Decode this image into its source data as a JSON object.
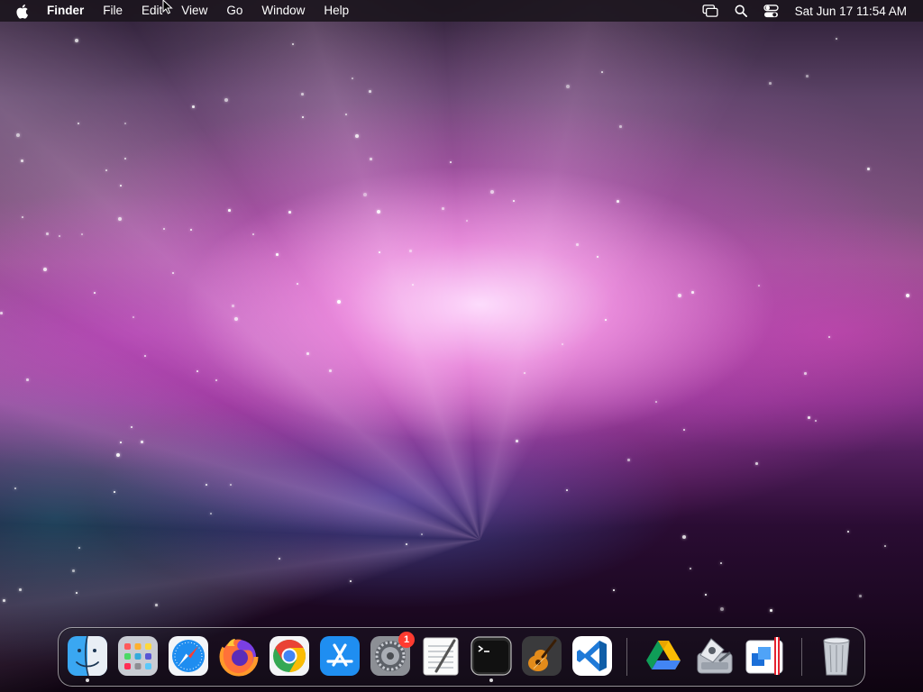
{
  "menubar": {
    "app_name": "Finder",
    "menus": [
      "File",
      "Edit",
      "View",
      "Go",
      "Window",
      "Help"
    ],
    "status_icons": [
      "screen-mirroring-icon",
      "spotlight-search-icon",
      "control-center-icon"
    ],
    "clock": "Sat Jun 17  11:54 AM"
  },
  "dock": {
    "items": [
      {
        "name": "Finder",
        "icon": "finder-icon",
        "running": true
      },
      {
        "name": "Launchpad",
        "icon": "launchpad-icon",
        "running": false
      },
      {
        "name": "Safari",
        "icon": "safari-icon",
        "running": false
      },
      {
        "name": "Firefox",
        "icon": "firefox-icon",
        "running": false
      },
      {
        "name": "Google Chrome",
        "icon": "chrome-icon",
        "running": false
      },
      {
        "name": "App Store",
        "icon": "app-store-icon",
        "running": false
      },
      {
        "name": "System Preferences",
        "icon": "system-preferences-icon",
        "running": false,
        "badge": "1"
      },
      {
        "name": "TextEdit",
        "icon": "textedit-icon",
        "running": false
      },
      {
        "name": "Terminal",
        "icon": "terminal-icon",
        "running": true
      },
      {
        "name": "GarageBand",
        "icon": "garageband-icon",
        "running": false
      },
      {
        "name": "Visual Studio Code",
        "icon": "vscode-icon",
        "running": false
      },
      {
        "name": "Google Drive",
        "icon": "google-drive-icon",
        "running": false
      },
      {
        "name": "Disk Utility",
        "icon": "disk-utility-icon",
        "running": false
      },
      {
        "name": "Parallels",
        "icon": "parallels-icon",
        "running": false
      },
      {
        "name": "Trash",
        "icon": "trash-icon",
        "running": false
      }
    ]
  },
  "colors": {
    "badge": "#ff3b30",
    "menubar_bg": "#1c161e"
  }
}
